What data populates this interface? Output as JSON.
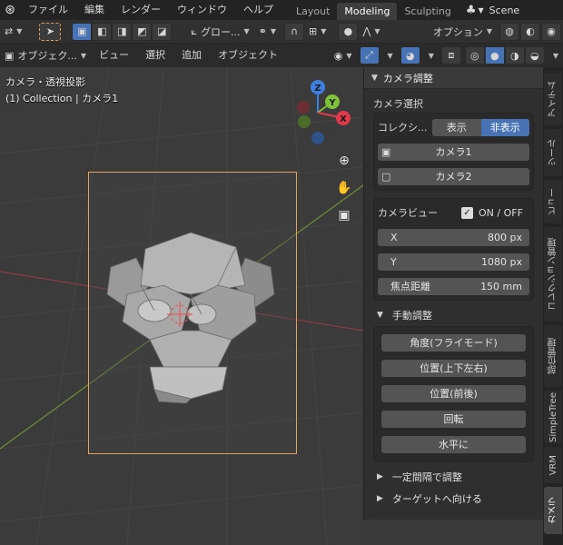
{
  "menu": {
    "items": [
      "ファイル",
      "編集",
      "レンダー",
      "ウィンドウ",
      "ヘルプ"
    ],
    "workspaces": [
      "Layout",
      "Modeling",
      "Sculpting"
    ],
    "active_workspace": "Modeling",
    "scene": "Scene"
  },
  "header1": {
    "transform_orientation": "グロー...",
    "options_label": "オプション"
  },
  "header2": {
    "mode": "オブジェク...",
    "menus": [
      "ビュー",
      "選択",
      "追加",
      "オブジェクト"
    ]
  },
  "viewport": {
    "view_name": "カメラ・透視投影",
    "collection_info": "(1) Collection | カメラ1",
    "gizmo_axes": [
      "Z",
      "Y",
      "X"
    ]
  },
  "panel": {
    "title": "カメラ調整",
    "camera_select_label": "カメラ選択",
    "collection_label": "コレクシ...",
    "show_label": "表示",
    "hide_label": "非表示",
    "cameras": [
      "カメラ1",
      "カメラ2"
    ],
    "camera_view_label": "カメラビュー",
    "on_off_label": "ON / OFF",
    "fields": [
      {
        "label": "X",
        "value": "800 px"
      },
      {
        "label": "Y",
        "value": "1080 px"
      },
      {
        "label": "焦点距離",
        "value": "150 mm"
      }
    ],
    "manual_label": "手動調整",
    "manual_buttons": [
      "角度(フライモード)",
      "位置(上下左右)",
      "位置(前後)",
      "回転",
      "水平に"
    ],
    "collapsed_sections": [
      "一定間隔で調整",
      "ターゲットへ向ける"
    ]
  },
  "tabs": [
    "アイテム",
    "ツール",
    "ビュー",
    "コレクション管理",
    "部位管理",
    "SimpleTree",
    "VRM",
    "カメラ"
  ],
  "active_tab": "カメラ",
  "colors": {
    "accent": "#4772b3",
    "frame": "#e3a35c",
    "axis_x": "#e2394d",
    "axis_y": "#80c13a",
    "axis_z": "#3d7fe0"
  }
}
